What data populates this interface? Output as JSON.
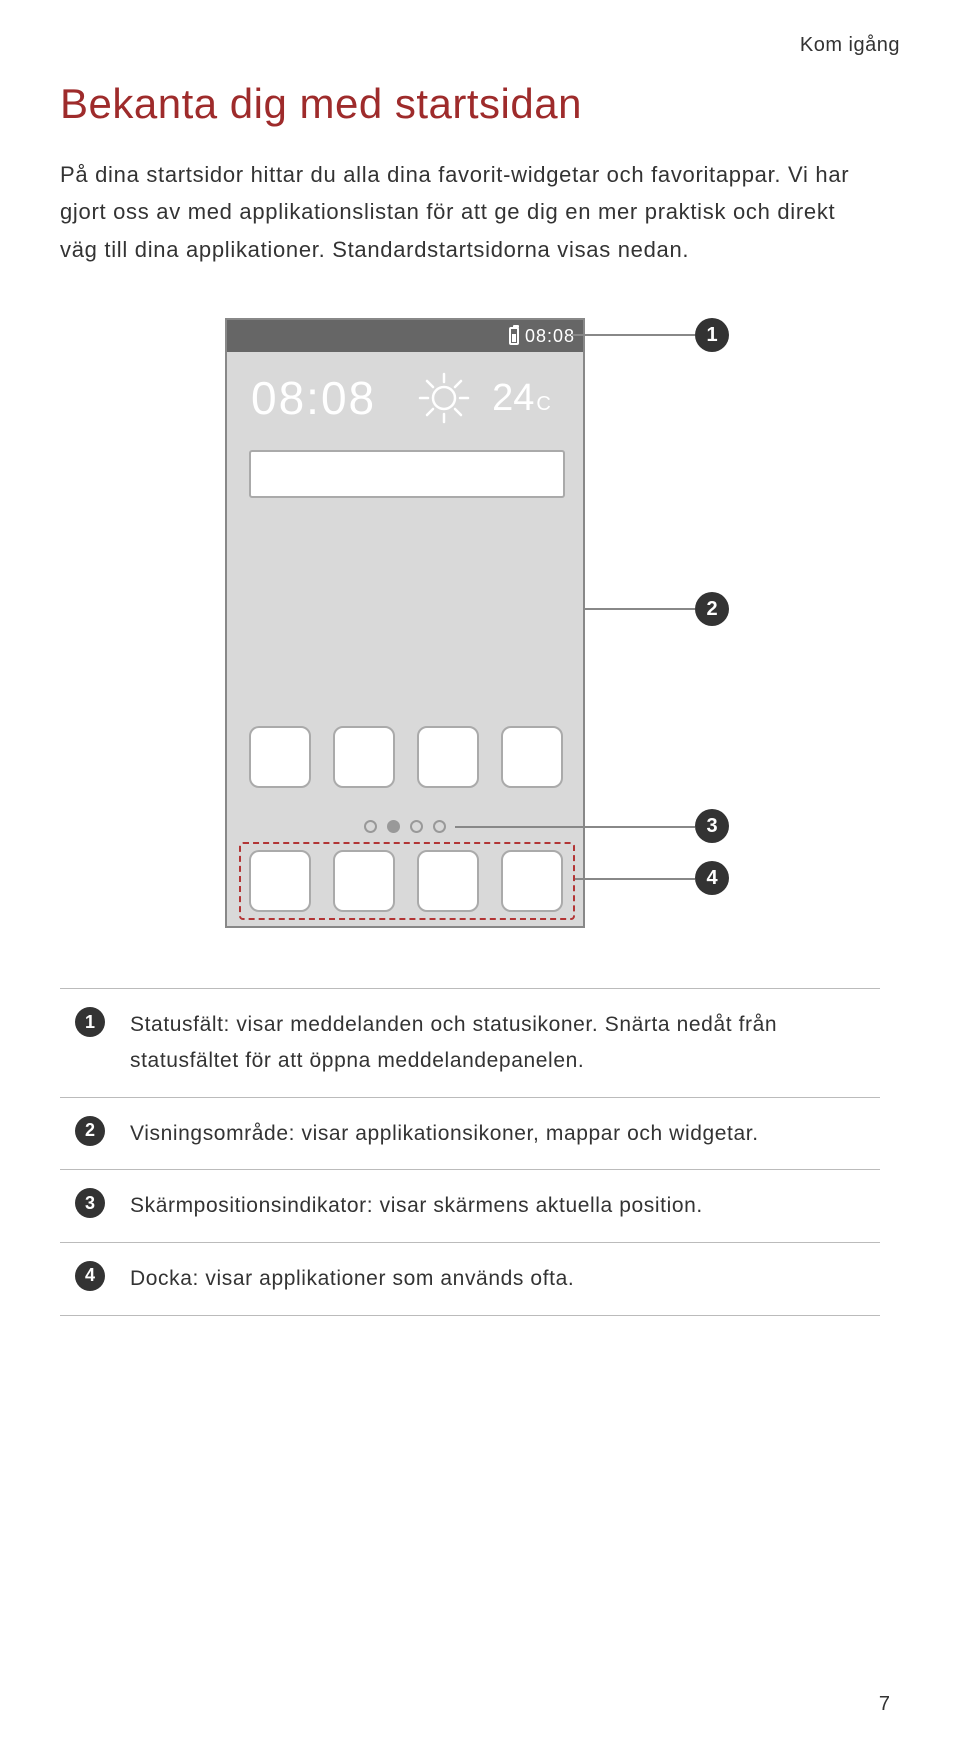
{
  "section_tag": "Kom igång",
  "title": "Bekanta dig med startsidan",
  "intro": "På dina startsidor hittar du alla dina favorit-widgetar och favoritappar. Vi har gjort oss av med applikationslistan för att ge dig en mer praktisk och direkt väg till dina applikationer. Standardstartsidorna visas nedan.",
  "phone": {
    "status_time": "08:08",
    "clock_time": "08:08",
    "temperature_value": "24",
    "temperature_unit": "C"
  },
  "callouts": {
    "c1": "1",
    "c2": "2",
    "c3": "3",
    "c4": "4"
  },
  "legend": [
    {
      "num": "1",
      "text": "Statusfält: visar meddelanden och statusikoner. Snärta nedåt från statusfältet för att öppna meddelandepanelen."
    },
    {
      "num": "2",
      "text": "Visningsområde: visar applikationsikoner, mappar och widgetar."
    },
    {
      "num": "3",
      "text": "Skärmpositionsindikator: visar skärmens aktuella position."
    },
    {
      "num": "4",
      "text": "Docka: visar applikationer som används ofta."
    }
  ],
  "page_number": "7"
}
